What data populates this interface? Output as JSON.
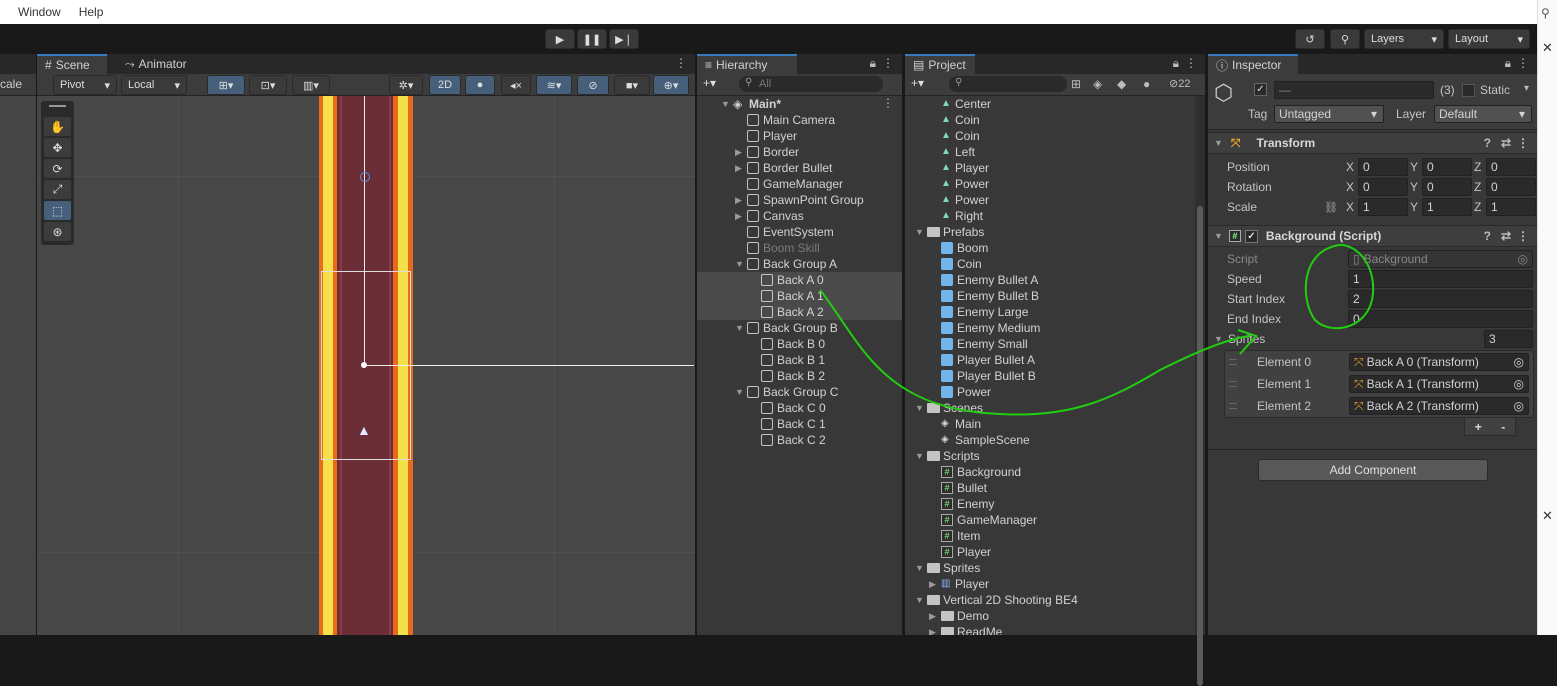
{
  "menu": [
    "Window",
    "Help"
  ],
  "toolbar": {
    "play_icon": "play-icon",
    "history_icon": "history-icon",
    "layers_label": "Layers",
    "layout_label": "Layout"
  },
  "scene": {
    "tab_scene": "Scene",
    "tab_animator": "Animator",
    "edge_label": "cale",
    "pivot_label": "Pivot",
    "local_label": "Local",
    "mode_2d": "2D"
  },
  "hierarchy": {
    "tab": "Hierarchy",
    "search_placeholder": "All",
    "items": [
      {
        "label": "Main*",
        "indent": 0,
        "kind": "scene",
        "arrow": "▼"
      },
      {
        "label": "Main Camera",
        "indent": 1,
        "kind": "go",
        "arrow": ""
      },
      {
        "label": "Player",
        "indent": 1,
        "kind": "go",
        "arrow": ""
      },
      {
        "label": "Border",
        "indent": 1,
        "kind": "go",
        "arrow": "▶"
      },
      {
        "label": "Border Bullet",
        "indent": 1,
        "kind": "go",
        "arrow": "▶"
      },
      {
        "label": "GameManager",
        "indent": 1,
        "kind": "go",
        "arrow": ""
      },
      {
        "label": "SpawnPoint Group",
        "indent": 1,
        "kind": "go",
        "arrow": "▶"
      },
      {
        "label": "Canvas",
        "indent": 1,
        "kind": "go",
        "arrow": "▶"
      },
      {
        "label": "EventSystem",
        "indent": 1,
        "kind": "go",
        "arrow": ""
      },
      {
        "label": "Boom Skill",
        "indent": 1,
        "kind": "go-dim",
        "arrow": ""
      },
      {
        "label": "Back Group A",
        "indent": 1,
        "kind": "go",
        "arrow": "▼"
      },
      {
        "label": "Back A 0",
        "indent": 2,
        "kind": "go",
        "arrow": "",
        "selected": true
      },
      {
        "label": "Back A 1",
        "indent": 2,
        "kind": "go",
        "arrow": "",
        "selected": true
      },
      {
        "label": "Back A 2",
        "indent": 2,
        "kind": "go",
        "arrow": "",
        "selected": true
      },
      {
        "label": "Back Group B",
        "indent": 1,
        "kind": "go",
        "arrow": "▼"
      },
      {
        "label": "Back B 0",
        "indent": 2,
        "kind": "go",
        "arrow": ""
      },
      {
        "label": "Back B 1",
        "indent": 2,
        "kind": "go",
        "arrow": ""
      },
      {
        "label": "Back B 2",
        "indent": 2,
        "kind": "go",
        "arrow": ""
      },
      {
        "label": "Back Group C",
        "indent": 1,
        "kind": "go",
        "arrow": "▼"
      },
      {
        "label": "Back C 0",
        "indent": 2,
        "kind": "go",
        "arrow": ""
      },
      {
        "label": "Back C 1",
        "indent": 2,
        "kind": "go",
        "arrow": ""
      },
      {
        "label": "Back C 2",
        "indent": 2,
        "kind": "go",
        "arrow": ""
      }
    ]
  },
  "project": {
    "tab": "Project",
    "hidden_count": "22",
    "items": [
      {
        "label": "Center",
        "indent": 2,
        "kind": "anim",
        "arrow": ""
      },
      {
        "label": "Coin",
        "indent": 2,
        "kind": "anim",
        "arrow": ""
      },
      {
        "label": "Coin",
        "indent": 2,
        "kind": "anim",
        "arrow": ""
      },
      {
        "label": "Left",
        "indent": 2,
        "kind": "anim",
        "arrow": ""
      },
      {
        "label": "Player",
        "indent": 2,
        "kind": "anim",
        "arrow": ""
      },
      {
        "label": "Power",
        "indent": 2,
        "kind": "anim",
        "arrow": ""
      },
      {
        "label": "Power",
        "indent": 2,
        "kind": "anim",
        "arrow": ""
      },
      {
        "label": "Right",
        "indent": 2,
        "kind": "anim",
        "arrow": ""
      },
      {
        "label": "Prefabs",
        "indent": 1,
        "kind": "folder",
        "arrow": "▼"
      },
      {
        "label": "Boom",
        "indent": 2,
        "kind": "prefab",
        "arrow": ""
      },
      {
        "label": "Coin",
        "indent": 2,
        "kind": "prefab",
        "arrow": ""
      },
      {
        "label": "Enemy Bullet A",
        "indent": 2,
        "kind": "prefab",
        "arrow": ""
      },
      {
        "label": "Enemy Bullet B",
        "indent": 2,
        "kind": "prefab",
        "arrow": ""
      },
      {
        "label": "Enemy Large",
        "indent": 2,
        "kind": "prefab",
        "arrow": ""
      },
      {
        "label": "Enemy Medium",
        "indent": 2,
        "kind": "prefab",
        "arrow": ""
      },
      {
        "label": "Enemy Small",
        "indent": 2,
        "kind": "prefab",
        "arrow": ""
      },
      {
        "label": "Player Bullet A",
        "indent": 2,
        "kind": "prefab",
        "arrow": ""
      },
      {
        "label": "Player Bullet B",
        "indent": 2,
        "kind": "prefab",
        "arrow": ""
      },
      {
        "label": "Power",
        "indent": 2,
        "kind": "prefab",
        "arrow": ""
      },
      {
        "label": "Scenes",
        "indent": 1,
        "kind": "folder",
        "arrow": "▼"
      },
      {
        "label": "Main",
        "indent": 2,
        "kind": "scene",
        "arrow": ""
      },
      {
        "label": "SampleScene",
        "indent": 2,
        "kind": "scene",
        "arrow": ""
      },
      {
        "label": "Scripts",
        "indent": 1,
        "kind": "folder",
        "arrow": "▼"
      },
      {
        "label": "Background",
        "indent": 2,
        "kind": "script",
        "arrow": ""
      },
      {
        "label": "Bullet",
        "indent": 2,
        "kind": "script",
        "arrow": ""
      },
      {
        "label": "Enemy",
        "indent": 2,
        "kind": "script",
        "arrow": ""
      },
      {
        "label": "GameManager",
        "indent": 2,
        "kind": "script",
        "arrow": ""
      },
      {
        "label": "Item",
        "indent": 2,
        "kind": "script",
        "arrow": ""
      },
      {
        "label": "Player",
        "indent": 2,
        "kind": "script",
        "arrow": ""
      },
      {
        "label": "Sprites",
        "indent": 1,
        "kind": "folder",
        "arrow": "▼"
      },
      {
        "label": "Player",
        "indent": 2,
        "kind": "sprite",
        "arrow": "▶"
      },
      {
        "label": "Vertical 2D Shooting BE4",
        "indent": 1,
        "kind": "folder",
        "arrow": "▼"
      },
      {
        "label": "Demo",
        "indent": 2,
        "kind": "folder",
        "arrow": "▶"
      },
      {
        "label": "ReadMe",
        "indent": 2,
        "kind": "folder",
        "arrow": "▶"
      }
    ]
  },
  "inspector": {
    "tab": "Inspector",
    "name_value": "—",
    "multi_count": "(3)",
    "static_label": "Static",
    "tag_label": "Tag",
    "tag_value": "Untagged",
    "layer_label": "Layer",
    "layer_value": "Default",
    "transform_title": "Transform",
    "position_label": "Position",
    "rotation_label": "Rotation",
    "scale_label": "Scale",
    "axis_x": "X",
    "axis_y": "Y",
    "axis_z": "Z",
    "position": [
      "0",
      "0",
      "0"
    ],
    "rotation": [
      "0",
      "0",
      "0"
    ],
    "scale": [
      "1",
      "1",
      "1"
    ],
    "component_title": "Background (Script)",
    "script_label": "Script",
    "script_value": "Background",
    "speed_label": "Speed",
    "speed_value": "1",
    "start_index_label": "Start Index",
    "start_index_value": "2",
    "end_index_label": "End Index",
    "end_index_value": "0",
    "sprites_label": "Sprites",
    "sprites_count": "3",
    "elements": [
      {
        "label": "Element 0",
        "value": "Back A 0 (Transform)"
      },
      {
        "label": "Element 1",
        "value": "Back A 1 (Transform)"
      },
      {
        "label": "Element 2",
        "value": "Back A 2 (Transform)"
      }
    ],
    "plus": "+",
    "minus": "-",
    "add_component": "Add Component"
  },
  "colors": {
    "accent": "#3a79bb",
    "annotation": "#22cc11",
    "lane_dark": "#6b2d36",
    "lane_yellow": "#f4e04a",
    "lane_orange": "#e86b1d"
  }
}
